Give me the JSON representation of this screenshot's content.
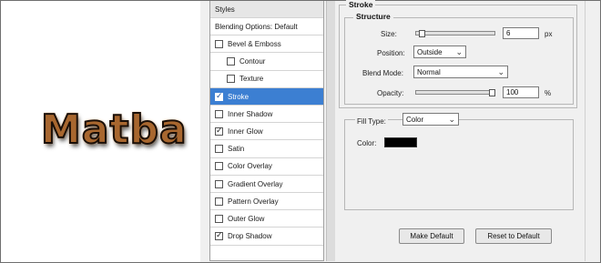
{
  "preview": {
    "text": "Matba"
  },
  "styles_panel": {
    "header": "Styles",
    "items": [
      {
        "label": "Blending Options: Default",
        "checkbox": false,
        "checked": false,
        "selected": false,
        "indent": 0
      },
      {
        "label": "Bevel & Emboss",
        "checkbox": true,
        "checked": false,
        "selected": false,
        "indent": 0
      },
      {
        "label": "Contour",
        "checkbox": true,
        "checked": false,
        "selected": false,
        "indent": 1
      },
      {
        "label": "Texture",
        "checkbox": true,
        "checked": false,
        "selected": false,
        "indent": 1
      },
      {
        "label": "Stroke",
        "checkbox": true,
        "checked": true,
        "selected": true,
        "indent": 0
      },
      {
        "label": "Inner Shadow",
        "checkbox": true,
        "checked": false,
        "selected": false,
        "indent": 0
      },
      {
        "label": "Inner Glow",
        "checkbox": true,
        "checked": true,
        "selected": false,
        "indent": 0
      },
      {
        "label": "Satin",
        "checkbox": true,
        "checked": false,
        "selected": false,
        "indent": 0
      },
      {
        "label": "Color Overlay",
        "checkbox": true,
        "checked": false,
        "selected": false,
        "indent": 0
      },
      {
        "label": "Gradient Overlay",
        "checkbox": true,
        "checked": false,
        "selected": false,
        "indent": 0
      },
      {
        "label": "Pattern Overlay",
        "checkbox": true,
        "checked": false,
        "selected": false,
        "indent": 0
      },
      {
        "label": "Outer Glow",
        "checkbox": true,
        "checked": false,
        "selected": false,
        "indent": 0
      },
      {
        "label": "Drop Shadow",
        "checkbox": true,
        "checked": true,
        "selected": false,
        "indent": 0
      }
    ]
  },
  "stroke": {
    "title": "Stroke",
    "structure_title": "Structure",
    "size": {
      "label": "Size:",
      "value": "6",
      "unit": "px",
      "level": 0.05
    },
    "position": {
      "label": "Position:",
      "value": "Outside"
    },
    "blend_mode": {
      "label": "Blend Mode:",
      "value": "Normal"
    },
    "opacity": {
      "label": "Opacity:",
      "value": "100",
      "unit": "%",
      "level": 1.0
    },
    "fill_type": {
      "label": "Fill Type:",
      "value": "Color"
    },
    "color": {
      "label": "Color:",
      "value": "#000000"
    },
    "buttons": {
      "make_default": "Make Default",
      "reset_default": "Reset to Default"
    }
  },
  "colors": {
    "selected_row": "#3c7fd2",
    "preview_text": "#a8672f"
  }
}
